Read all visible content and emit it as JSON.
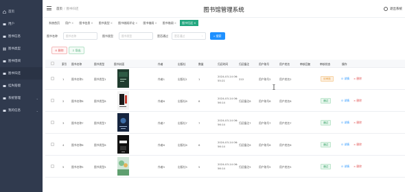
{
  "sidebar": {
    "items": [
      {
        "label": "首页",
        "icon": "home-icon"
      },
      {
        "label": "用户",
        "icon": "user-icon"
      },
      {
        "label": "图书信息",
        "icon": "book-icon"
      },
      {
        "label": "图书类型",
        "icon": "grid-icon"
      },
      {
        "label": "图书借阅",
        "icon": "book-icon"
      },
      {
        "label": "图书归还",
        "icon": "book-icon"
      },
      {
        "label": "挂失赔偿",
        "icon": "book-icon"
      },
      {
        "label": "系统管理",
        "icon": "settings-icon",
        "chevron": "⌄"
      },
      {
        "label": "我的信息",
        "icon": "profile-icon",
        "chevron": "⌄"
      }
    ],
    "bg_color": "#303a4e"
  },
  "header": {
    "breadcrumb_home": "首页",
    "breadcrumb_current": "图书归还",
    "app_title": "图书馆管理系统",
    "logout_label": "退出系统"
  },
  "tabs": [
    {
      "label": "系统首页",
      "close": ""
    },
    {
      "label": "用户",
      "close": "×"
    },
    {
      "label": "图书信息",
      "close": "×"
    },
    {
      "label": "图书类型",
      "close": "×"
    },
    {
      "label": "图书借阅评论",
      "close": "×"
    },
    {
      "label": "图书借阅",
      "close": "×"
    },
    {
      "label": "图书借阅",
      "close": "×"
    },
    {
      "label": "图书归还",
      "close": "×",
      "active": true
    }
  ],
  "search": {
    "name_label": "图书名称",
    "name_placeholder": "图书名称",
    "type_label": "图书类型",
    "type_placeholder": "图书类型",
    "review_label": "是否通过",
    "review_placeholder": "是否通过",
    "search_button": "搜索"
  },
  "actions": {
    "delete_label": "删除",
    "export_label": "导出"
  },
  "table": {
    "headers": [
      "索引",
      "图书名称",
      "图书类型",
      "图书封面",
      "作者",
      "出版社",
      "数量",
      "归还时间",
      "归还备注",
      "用户账号",
      "用户姓名",
      "审核回复",
      "审核状态",
      "操作"
    ],
    "rows": [
      {
        "index": "1",
        "name": "图书名称1",
        "type": "图书类型1",
        "author": "作者1",
        "publisher": "出版社1",
        "qty": "1",
        "date": "2024-03-14 06:",
        "time": "55:21",
        "remark": "222",
        "account": "用户账号2",
        "username": "用户姓名2",
        "reply": "",
        "status": "待审核",
        "status_kind": "wait"
      },
      {
        "index": "2",
        "name": "图书名称8",
        "type": "图书类型8",
        "author": "作者8",
        "publisher": "出版社8",
        "qty": "8",
        "date": "2024-03-14 06:",
        "time": "56:14",
        "remark": "归还备注8",
        "account": "用户账号8",
        "username": "用户姓名8",
        "reply": "",
        "status": "通过",
        "status_kind": "pass"
      },
      {
        "index": "3",
        "name": "图书名称7",
        "type": "图书类型7",
        "author": "作者7",
        "publisher": "出版社7",
        "qty": "7",
        "date": "2024-03-14 06:",
        "time": "56:14",
        "remark": "归还备注7",
        "account": "用户账号7",
        "username": "用户姓名7",
        "reply": "",
        "status": "通过",
        "status_kind": "pass"
      },
      {
        "index": "4",
        "name": "图书名称6",
        "type": "图书类型6",
        "author": "作者6",
        "publisher": "出版社6",
        "qty": "6",
        "date": "2024-03-14 06:",
        "time": "56:14",
        "remark": "归还备注6",
        "account": "用户账号6",
        "username": "用户姓名6",
        "reply": "",
        "status": "通过",
        "status_kind": "pass"
      },
      {
        "index": "5",
        "name": "图书名称5",
        "type": "图书类型5",
        "author": "作者5",
        "publisher": "出版社5",
        "qty": "5",
        "date": "2024-03-14 06:",
        "time": "56:14",
        "remark": "归还备注5",
        "account": "用户账号5",
        "username": "用户姓名5",
        "reply": "",
        "status": "通过",
        "status_kind": "pass"
      }
    ],
    "detail_label": "详情",
    "delete_label": "删除"
  },
  "colors": {
    "accent": "#23a77f",
    "primary": "#1e90ff",
    "danger": "#e05252",
    "pending": "#e69b3a"
  }
}
